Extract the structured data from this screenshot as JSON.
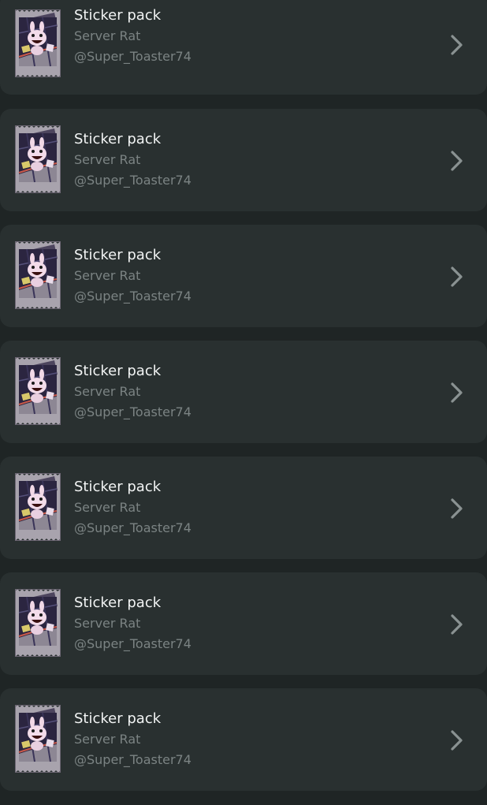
{
  "packs": [
    {
      "title": "Sticker pack",
      "subtitle": "Server Rat",
      "author": "@Super_Toaster74",
      "thumbnail": "sticker-pack-thumbnail",
      "action_icon": "chevron-right-icon"
    },
    {
      "title": "Sticker pack",
      "subtitle": "Server Rat",
      "author": "@Super_Toaster74",
      "thumbnail": "sticker-pack-thumbnail",
      "action_icon": "chevron-right-icon"
    },
    {
      "title": "Sticker pack",
      "subtitle": "Server Rat",
      "author": "@Super_Toaster74",
      "thumbnail": "sticker-pack-thumbnail",
      "action_icon": "chevron-right-icon"
    },
    {
      "title": "Sticker pack",
      "subtitle": "Server Rat",
      "author": "@Super_Toaster74",
      "thumbnail": "sticker-pack-thumbnail",
      "action_icon": "chevron-right-icon"
    },
    {
      "title": "Sticker pack",
      "subtitle": "Server Rat",
      "author": "@Super_Toaster74",
      "thumbnail": "sticker-pack-thumbnail",
      "action_icon": "chevron-right-icon"
    },
    {
      "title": "Sticker pack",
      "subtitle": "Server Rat",
      "author": "@Super_Toaster74",
      "thumbnail": "sticker-pack-thumbnail",
      "action_icon": "chevron-right-icon"
    },
    {
      "title": "Sticker pack",
      "subtitle": "Server Rat",
      "author": "@Super_Toaster74",
      "thumbnail": "sticker-pack-thumbnail",
      "action_icon": "chevron-right-icon"
    }
  ],
  "colors": {
    "background": "#1f2525",
    "card": "#293030",
    "title": "#f2f4f4",
    "secondary_text": "#7b8383",
    "chevron": "#8a9292"
  }
}
